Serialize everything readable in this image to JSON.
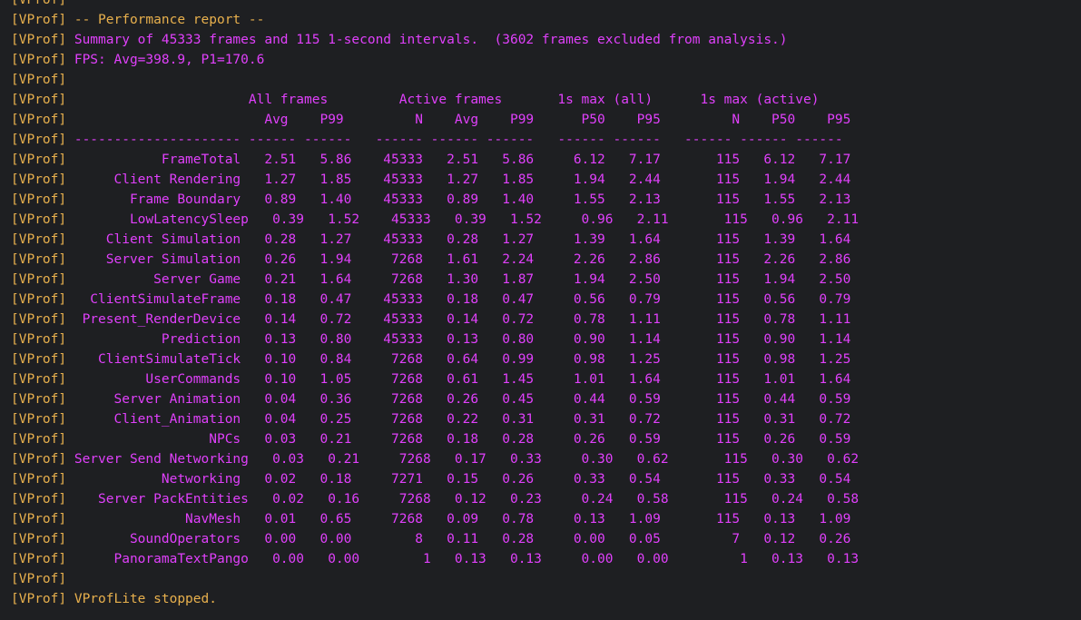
{
  "colors": {
    "background": "#1e1f22",
    "prefix": "#e8b04d",
    "text_orange": "#e8b04d",
    "text_magenta": "#e040fb"
  },
  "prefix": "[VProf]",
  "lines": [
    {
      "text": "",
      "color": "orange"
    },
    {
      "text": " -- Performance report --",
      "color": "orange"
    },
    {
      "text": " Summary of 45333 frames and 115 1-second intervals.  (3602 frames excluded from analysis.)",
      "color": "magenta"
    },
    {
      "text": " FPS: Avg=398.9, P1=170.6",
      "color": "magenta"
    },
    {
      "text": "",
      "color": "magenta"
    },
    {
      "text": "                       All frames         Active frames       1s max (all)      1s max (active)",
      "color": "magenta"
    },
    {
      "text": "                         Avg    P99         N    Avg    P99      P50    P95         N    P50    P95",
      "color": "magenta"
    },
    {
      "text": " --------------------- ------ ------   ------ ------ ------   ------ ------   ------ ------ ------",
      "color": "magenta"
    },
    {
      "text": "            FrameTotal   2.51   5.86    45333   2.51   5.86     6.12   7.17       115   6.12   7.17",
      "color": "magenta"
    },
    {
      "text": "      Client Rendering   1.27   1.85    45333   1.27   1.85     1.94   2.44       115   1.94   2.44",
      "color": "magenta"
    },
    {
      "text": "        Frame Boundary   0.89   1.40    45333   0.89   1.40     1.55   2.13       115   1.55   2.13",
      "color": "magenta"
    },
    {
      "text": "        LowLatencySleep   0.39   1.52    45333   0.39   1.52     0.96   2.11       115   0.96   2.11",
      "color": "magenta"
    },
    {
      "text": "     Client Simulation   0.28   1.27    45333   0.28   1.27     1.39   1.64       115   1.39   1.64",
      "color": "magenta"
    },
    {
      "text": "     Server Simulation   0.26   1.94     7268   1.61   2.24     2.26   2.86       115   2.26   2.86",
      "color": "magenta"
    },
    {
      "text": "           Server Game   0.21   1.64     7268   1.30   1.87     1.94   2.50       115   1.94   2.50",
      "color": "magenta"
    },
    {
      "text": "   ClientSimulateFrame   0.18   0.47    45333   0.18   0.47     0.56   0.79       115   0.56   0.79",
      "color": "magenta"
    },
    {
      "text": "  Present_RenderDevice   0.14   0.72    45333   0.14   0.72     0.78   1.11       115   0.78   1.11",
      "color": "magenta"
    },
    {
      "text": "            Prediction   0.13   0.80    45333   0.13   0.80     0.90   1.14       115   0.90   1.14",
      "color": "magenta"
    },
    {
      "text": "    ClientSimulateTick   0.10   0.84     7268   0.64   0.99     0.98   1.25       115   0.98   1.25",
      "color": "magenta"
    },
    {
      "text": "          UserCommands   0.10   1.05     7268   0.61   1.45     1.01   1.64       115   1.01   1.64",
      "color": "magenta"
    },
    {
      "text": "      Server Animation   0.04   0.36     7268   0.26   0.45     0.44   0.59       115   0.44   0.59",
      "color": "magenta"
    },
    {
      "text": "      Client_Animation   0.04   0.25     7268   0.22   0.31     0.31   0.72       115   0.31   0.72",
      "color": "magenta"
    },
    {
      "text": "                  NPCs   0.03   0.21     7268   0.18   0.28     0.26   0.59       115   0.26   0.59",
      "color": "magenta"
    },
    {
      "text": " Server Send Networking   0.03   0.21     7268   0.17   0.33     0.30   0.62       115   0.30   0.62",
      "color": "magenta"
    },
    {
      "text": "            Networking   0.02   0.18     7271   0.15   0.26     0.33   0.54       115   0.33   0.54",
      "color": "magenta"
    },
    {
      "text": "    Server PackEntities   0.02   0.16     7268   0.12   0.23     0.24   0.58       115   0.24   0.58",
      "color": "magenta"
    },
    {
      "text": "               NavMesh   0.01   0.65     7268   0.09   0.78     0.13   1.09       115   0.13   1.09",
      "color": "magenta"
    },
    {
      "text": "        SoundOperators   0.00   0.00        8   0.11   0.28     0.00   0.05         7   0.12   0.26",
      "color": "magenta"
    },
    {
      "text": "      PanoramaTextPango   0.00   0.00        1   0.13   0.13     0.00   0.00         1   0.13   0.13",
      "color": "magenta"
    },
    {
      "text": "",
      "color": "magenta"
    },
    {
      "text": " VProfLite stopped.",
      "color": "orange"
    }
  ]
}
